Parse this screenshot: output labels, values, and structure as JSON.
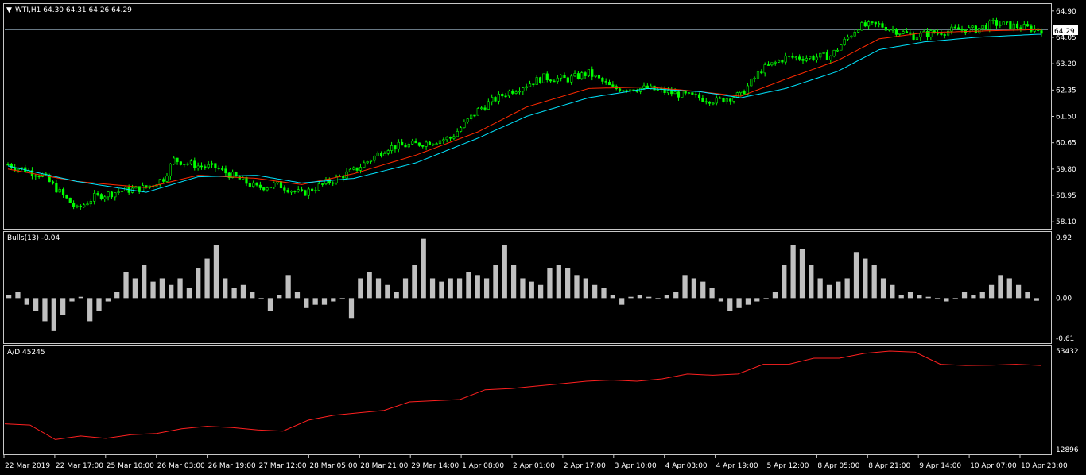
{
  "chart_data": [
    {
      "type": "candlestick",
      "title": "WTI,H1  64.30 64.31 64.26 64.29",
      "current_price_label": "64.29",
      "ylim": [
        57.9,
        65.1
      ],
      "y_ticks": [
        "64.90",
        "64.05",
        "63.20",
        "62.35",
        "61.50",
        "60.65",
        "59.80",
        "58.95",
        "58.10"
      ],
      "colors": {
        "up": "#00ff00",
        "down": "#00ff00",
        "ma_fast": "#ff2a00",
        "ma_slow": "#00e5ff",
        "price_line": "#8aa0b0"
      },
      "series": [
        {
          "name": "close",
          "x_index": [
            0,
            10,
            20,
            25,
            33,
            40,
            45,
            48,
            55,
            60,
            72,
            78,
            85,
            95,
            100,
            110,
            118,
            128,
            136,
            140,
            145,
            155,
            162,
            168,
            175,
            185,
            190,
            200,
            205,
            212,
            218,
            225,
            232,
            238,
            246,
            252,
            256,
            262,
            268,
            275,
            280,
            285,
            292,
            298
          ],
          "values": [
            59.95,
            59.6,
            58.5,
            58.9,
            59.1,
            59.2,
            59.5,
            60.1,
            59.9,
            59.85,
            59.2,
            59.3,
            59.0,
            59.5,
            59.75,
            60.5,
            60.6,
            60.8,
            61.7,
            62.0,
            62.3,
            62.75,
            62.7,
            62.9,
            62.4,
            62.4,
            62.3,
            62.1,
            62.0,
            62.2,
            63.0,
            63.4,
            63.4,
            63.45,
            64.4,
            64.45,
            64.3,
            64.1,
            64.2,
            64.3,
            64.3,
            64.5,
            64.4,
            64.3
          ]
        },
        {
          "name": "ma_fast",
          "x_index": [
            0,
            20,
            40,
            55,
            72,
            85,
            100,
            118,
            136,
            150,
            168,
            185,
            200,
            212,
            225,
            240,
            252,
            265,
            280,
            298
          ],
          "values": [
            59.8,
            59.4,
            59.2,
            59.6,
            59.5,
            59.3,
            59.65,
            60.25,
            61.0,
            61.8,
            62.4,
            62.45,
            62.3,
            62.15,
            62.7,
            63.3,
            64.0,
            64.2,
            64.25,
            64.3
          ]
        },
        {
          "name": "ma_slow",
          "x_index": [
            0,
            20,
            40,
            55,
            72,
            85,
            100,
            118,
            136,
            150,
            168,
            185,
            200,
            212,
            225,
            240,
            252,
            265,
            280,
            298
          ],
          "values": [
            59.9,
            59.4,
            59.05,
            59.55,
            59.6,
            59.35,
            59.5,
            60.0,
            60.8,
            61.5,
            62.1,
            62.4,
            62.3,
            62.1,
            62.4,
            62.95,
            63.65,
            63.9,
            64.05,
            64.15
          ]
        }
      ]
    },
    {
      "type": "bar",
      "title": "Bulls(13) -0.04",
      "ylim": [
        -0.61,
        0.92
      ],
      "y_ticks": [
        "0.92",
        "0.00",
        "-0.61"
      ],
      "colors": {
        "bar": "#c0c0c0"
      },
      "values": [
        0.05,
        0.1,
        -0.1,
        -0.2,
        -0.35,
        -0.5,
        -0.25,
        -0.05,
        0.02,
        -0.35,
        -0.2,
        -0.05,
        0.1,
        0.4,
        0.3,
        0.5,
        0.25,
        0.3,
        0.2,
        0.3,
        0.15,
        0.45,
        0.6,
        0.8,
        0.3,
        0.15,
        0.2,
        0.1,
        0.0,
        -0.2,
        0.05,
        0.35,
        0.1,
        -0.15,
        -0.1,
        -0.1,
        -0.05,
        0.0,
        -0.3,
        0.3,
        0.4,
        0.3,
        0.2,
        0.1,
        0.3,
        0.5,
        0.9,
        0.3,
        0.25,
        0.3,
        0.3,
        0.4,
        0.35,
        0.3,
        0.5,
        0.8,
        0.5,
        0.3,
        0.25,
        0.2,
        0.45,
        0.5,
        0.45,
        0.35,
        0.3,
        0.2,
        0.15,
        0.05,
        -0.1,
        0.02,
        0.05,
        0.02,
        0.0,
        0.05,
        0.1,
        0.35,
        0.3,
        0.25,
        0.15,
        -0.05,
        -0.2,
        -0.15,
        -0.1,
        -0.05,
        0.0,
        0.1,
        0.5,
        0.8,
        0.75,
        0.5,
        0.3,
        0.2,
        0.25,
        0.3,
        0.7,
        0.6,
        0.5,
        0.3,
        0.2,
        0.05,
        0.1,
        0.05,
        0.02,
        0.0,
        -0.05,
        0.0,
        0.1,
        0.05,
        0.1,
        0.2,
        0.35,
        0.3,
        0.2,
        0.1,
        -0.04
      ],
      "zero_line": true
    },
    {
      "type": "line",
      "title": "A/D 45245",
      "ylim": [
        12896,
        53432
      ],
      "y_ticks": [
        "53432",
        "12896"
      ],
      "colors": {
        "line": "#ff2020"
      },
      "values": [
        23500,
        23000,
        17000,
        18500,
        17500,
        19000,
        19500,
        21500,
        22500,
        22000,
        21000,
        20500,
        25000,
        27000,
        28000,
        29000,
        32500,
        33000,
        33500,
        37500,
        38000,
        39000,
        40000,
        41000,
        41500,
        41000,
        42000,
        44000,
        43500,
        44000,
        48000,
        48000,
        50500,
        50500,
        52500,
        53432,
        53000,
        48000,
        47500,
        47600,
        48000,
        47500
      ]
    }
  ],
  "x_ticks": [
    "22 Mar 2019",
    "22 Mar 17:00",
    "25 Mar 10:00",
    "26 Mar 03:00",
    "26 Mar 19:00",
    "27 Mar 12:00",
    "28 Mar 05:00",
    "28 Mar 21:00",
    "29 Mar 14:00",
    "1 Apr 08:00",
    "2 Apr 01:00",
    "2 Apr 17:00",
    "3 Apr 10:00",
    "4 Apr 03:00",
    "4 Apr 19:00",
    "5 Apr 12:00",
    "8 Apr 05:00",
    "8 Apr 21:00",
    "9 Apr 14:00",
    "10 Apr 07:00",
    "10 Apr 23:00"
  ]
}
